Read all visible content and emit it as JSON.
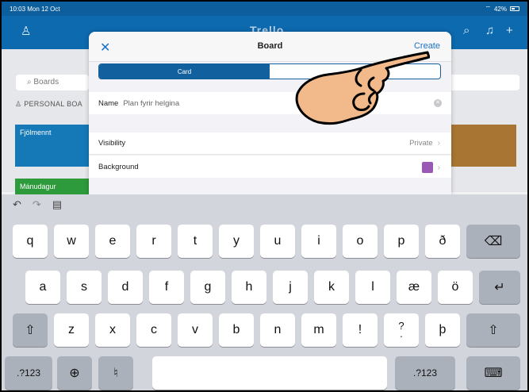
{
  "status_bar": {
    "time": "10:03",
    "date": "Mon 12 Oct",
    "battery": "42%"
  },
  "app": {
    "logo": "Trello",
    "boards_search_placeholder": "Boards",
    "personal_boards_label": "PERSONAL BOA",
    "tiles": [
      "Fjölmennt",
      "Mánudagur"
    ]
  },
  "modal": {
    "close_label": "✕",
    "title": "Board",
    "create_label": "Create",
    "segments": [
      "Card",
      ""
    ],
    "name_label": "Name",
    "name_value": "Plan fyrir helgina",
    "visibility_label": "Visibility",
    "visibility_value": "Private",
    "background_label": "Background",
    "background_color": "#9b59b6"
  },
  "keyboard": {
    "row1": [
      "q",
      "w",
      "e",
      "r",
      "t",
      "y",
      "u",
      "i",
      "o",
      "p",
      "ð"
    ],
    "row2": [
      "a",
      "s",
      "d",
      "f",
      "g",
      "h",
      "j",
      "k",
      "l",
      "æ",
      "ö"
    ],
    "row3": [
      "z",
      "x",
      "c",
      "v",
      "b",
      "n",
      "m",
      "!",
      "?",
      "þ"
    ],
    "row3_punct_bottom": ".",
    "numbers_label": ".?123",
    "colors": {
      "accent": "#1a72c7",
      "appbar": "#0d6aaf"
    }
  }
}
